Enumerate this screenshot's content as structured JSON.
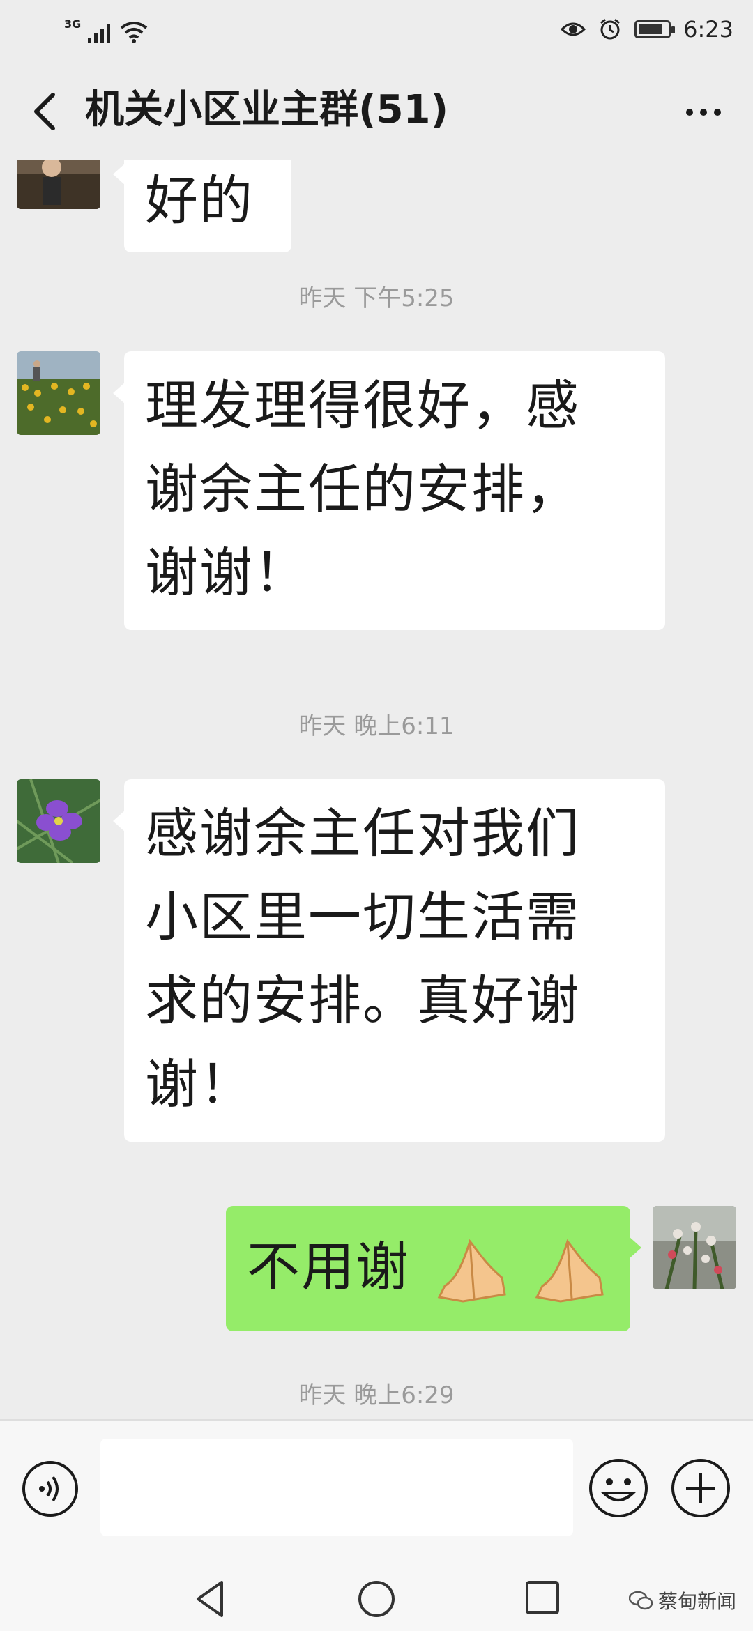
{
  "status_bar": {
    "network": "3G",
    "time": "6:23",
    "battery_level": 0.85
  },
  "header": {
    "title": "机关小区业主群(51)"
  },
  "messages": [
    {
      "type": "text",
      "side": "left",
      "text": "好的",
      "avatar": "person-photo-avatar"
    },
    {
      "type": "time",
      "text": "昨天 下午5:25"
    },
    {
      "type": "text",
      "side": "left",
      "lines": [
        "理发理得很好，感",
        "谢余主任的安排，",
        "谢谢！"
      ],
      "avatar": "sunflower-field-avatar"
    },
    {
      "type": "time",
      "text": "昨天 晚上6:11"
    },
    {
      "type": "text",
      "side": "left",
      "lines": [
        "感谢余主任对我们",
        "小区里一切生活需",
        "求的安排。真好谢",
        "谢！"
      ],
      "avatar": "purple-flower-avatar"
    },
    {
      "type": "text",
      "side": "right",
      "text": "不用谢",
      "emojis": [
        "folded-hands-icon",
        "folded-hands-icon"
      ],
      "avatar": "garden-flowers-avatar"
    },
    {
      "type": "time",
      "text": "昨天 晚上6:29"
    }
  ],
  "watermark": {
    "text": "蔡甸新闻"
  },
  "colors": {
    "background": "#ededed",
    "bubble_self": "#95ec69",
    "bubble_other": "#ffffff",
    "timestamp": "#9a9a9a"
  }
}
